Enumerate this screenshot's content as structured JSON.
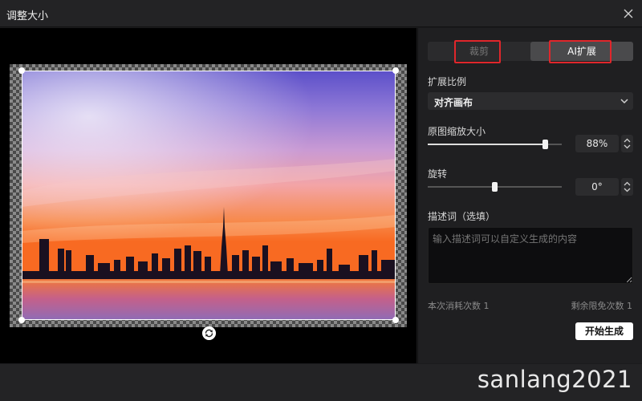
{
  "window": {
    "title": "调整大小",
    "close_icon": "close-icon"
  },
  "tabs": [
    {
      "label": "裁剪",
      "active": false
    },
    {
      "label": "AI扩展",
      "active": true
    }
  ],
  "expand_ratio": {
    "label": "扩展比例",
    "value": "对齐画布"
  },
  "scale": {
    "label": "原图缩放大小",
    "value": "88%",
    "fraction": 0.88
  },
  "rotation": {
    "label": "旋转",
    "value": "0°",
    "fraction": 0.5
  },
  "prompt": {
    "label": "描述词（选填）",
    "placeholder": "输入描述词可以自定义生成的内容"
  },
  "footer": {
    "cost": "本次消耗次数 1",
    "remaining": "剩余限免次数 1"
  },
  "generate_button": "开始生成",
  "watermark": "sanlang2021",
  "colors": {
    "highlight": "#e0262b",
    "accent": "#ffffff"
  }
}
